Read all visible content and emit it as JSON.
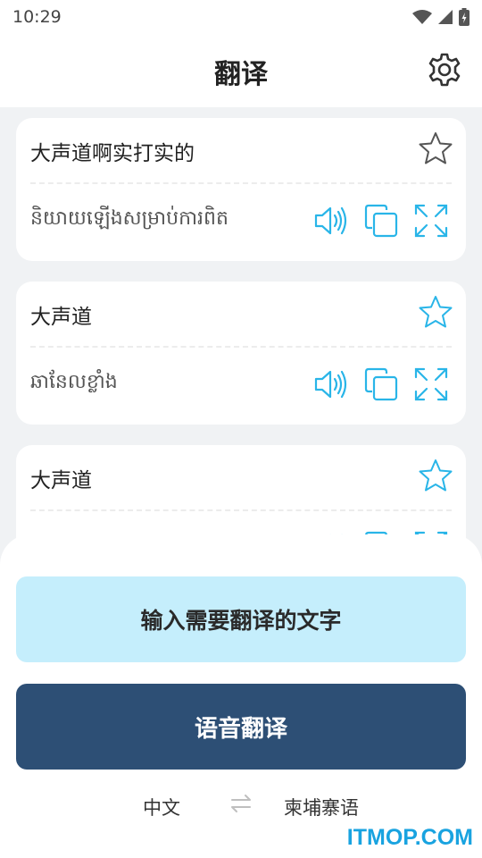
{
  "status_bar": {
    "time": "10:29"
  },
  "header": {
    "title": "翻译"
  },
  "translations": [
    {
      "source": "大声道啊实打实的",
      "target": "និយាយឡើងសម្រាប់ការពិត",
      "favorited": true
    },
    {
      "source": "大声道",
      "target": "ឆានែលខ្លាំង",
      "favorited": false
    },
    {
      "source": "大声道",
      "target": "",
      "favorited": false
    }
  ],
  "bottom": {
    "text_input_label": "输入需要翻译的文字",
    "voice_label": "语音翻译",
    "source_language": "中文",
    "target_language": "柬埔寨语"
  },
  "watermark": "ITMOP.COM",
  "colors": {
    "accent": "#29b5e8",
    "voice_button": "#2d4f75",
    "text_button": "#c5eefc"
  },
  "icons": [
    "wifi-icon",
    "signal-icon",
    "battery-icon",
    "gear-icon",
    "star-icon",
    "speaker-icon",
    "copy-icon",
    "expand-icon",
    "swap-icon"
  ]
}
